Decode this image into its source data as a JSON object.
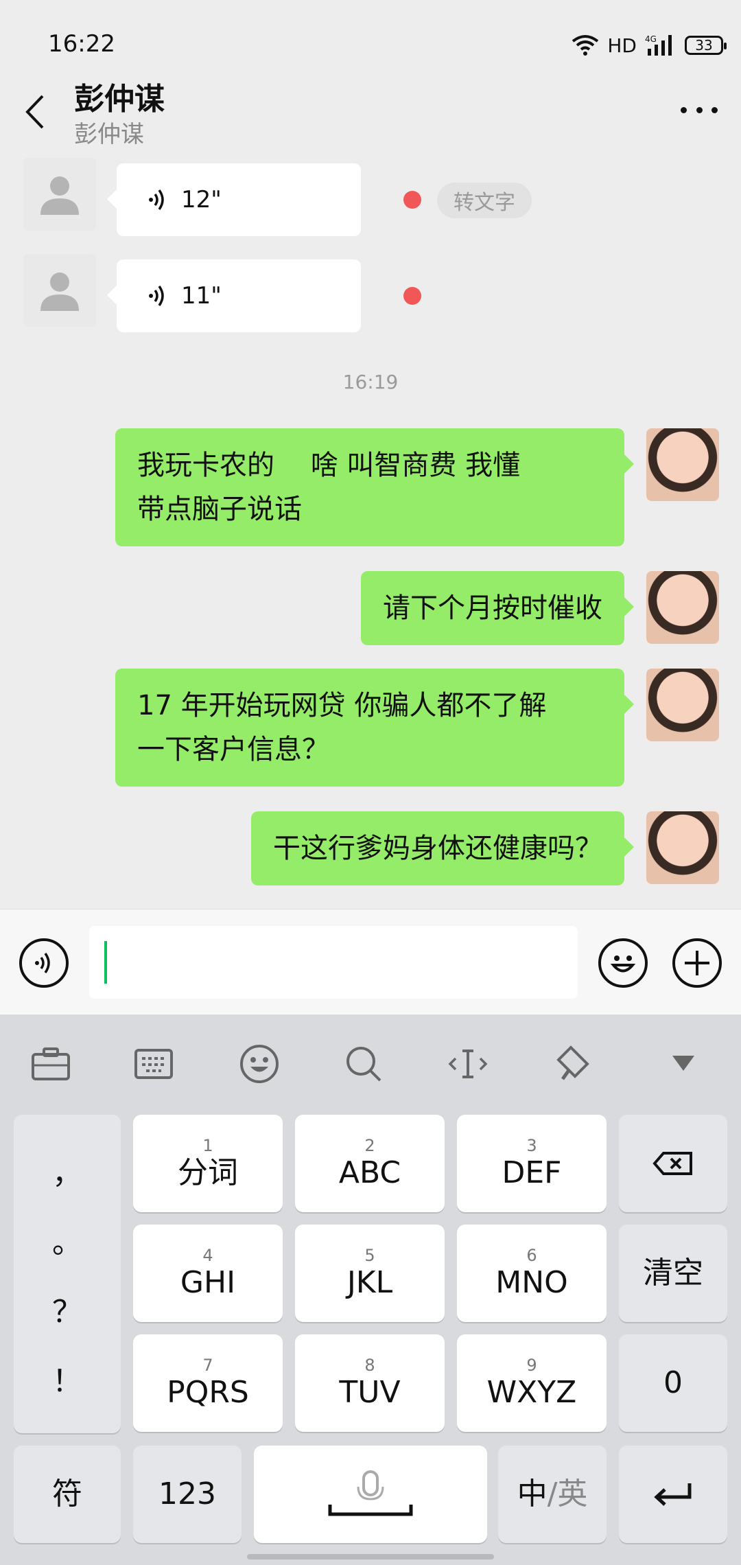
{
  "status_bar": {
    "time": "16:22",
    "network": "HD",
    "signal": "4G",
    "battery": "33"
  },
  "header": {
    "title": "彭仲谋",
    "subtitle": "彭仲谋"
  },
  "messages": {
    "voice_1": {
      "duration": "12\"",
      "transcribe_label": "转文字"
    },
    "voice_2": {
      "duration": "11\""
    },
    "time_separator": "16:19",
    "sent_1": {
      "line1": "我玩卡农的　 啥 叫智商费 我懂",
      "line2": "带点脑子说话"
    },
    "sent_2": {
      "text": "请下个月按时催收"
    },
    "sent_3": {
      "line1": "17 年开始玩网贷  你骗人都不了解",
      "line2": "一下客户信息？"
    },
    "sent_4": {
      "text": "干这行爹妈身体还健康吗？"
    }
  },
  "keyboard": {
    "punct": [
      "，",
      "。",
      "？",
      "！"
    ],
    "keys": {
      "k1": {
        "num": "1",
        "label": "分词"
      },
      "k2": {
        "num": "2",
        "label": "ABC"
      },
      "k3": {
        "num": "3",
        "label": "DEF"
      },
      "k4": {
        "num": "4",
        "label": "GHI"
      },
      "k5": {
        "num": "5",
        "label": "JKL"
      },
      "k6": {
        "num": "6",
        "label": "MNO"
      },
      "k7": {
        "num": "7",
        "label": "PQRS"
      },
      "k8": {
        "num": "8",
        "label": "TUV"
      },
      "k9": {
        "num": "9",
        "label": "WXYZ"
      }
    },
    "clear_label": "清空",
    "zero_label": "0",
    "symbol_label": "符",
    "numeric_label": "123",
    "lang_zh": "中",
    "lang_sep": "/",
    "lang_en": "英"
  },
  "colors": {
    "sent_bubble": "#95ec69",
    "unread": "#f25757",
    "background": "#ededed",
    "caret": "#07c160"
  }
}
